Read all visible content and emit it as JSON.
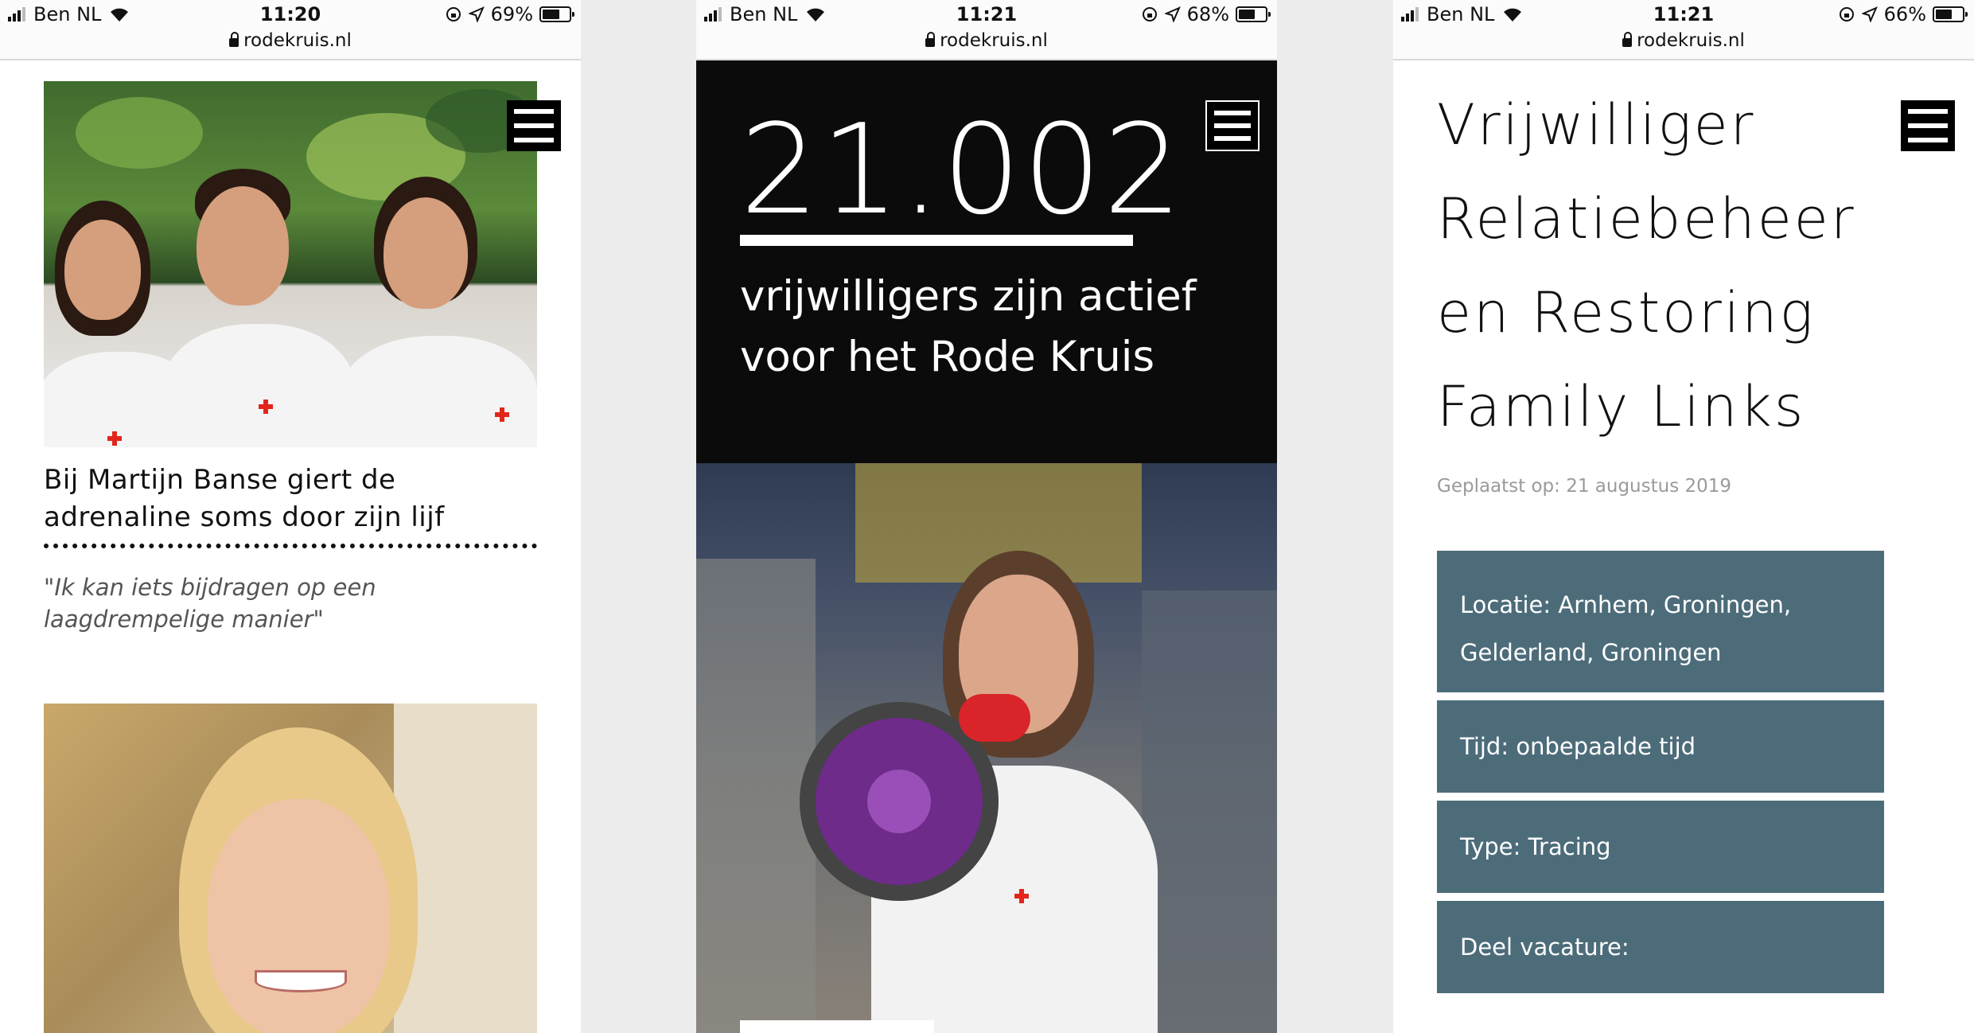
{
  "screens": [
    {
      "status": {
        "carrier": "Ben NL",
        "time": "11:20",
        "battery": "69%",
        "battery_level": 0.69,
        "url": "rodekruis.nl"
      },
      "article": {
        "title": "Bij Martijn Banse giert de adrenaline soms door zijn lijf",
        "quote": "\"Ik kan iets bijdragen op een laagdrempelige manier\""
      },
      "photo_logo": "Rode Kruis"
    },
    {
      "status": {
        "carrier": "Ben NL",
        "time": "11:21",
        "battery": "68%",
        "battery_level": 0.68,
        "url": "rodekruis.nl"
      },
      "stat": {
        "number": "21.002",
        "text": "vrijwilligers zijn actief voor het Rode Kruis"
      },
      "photo_logo": "Rode Kruis"
    },
    {
      "status": {
        "carrier": "Ben NL",
        "time": "11:21",
        "battery": "66%",
        "battery_level": 0.66,
        "url": "rodekruis.nl"
      },
      "job": {
        "title": "Vrijwilliger Relatiebeheer en Restoring Family Links",
        "posted": "Geplaatst op: 21 augustus 2019",
        "location_line1": "Locatie: Arnhem, Groningen,",
        "location_line2": "Gelderland, Groningen",
        "time": "Tijd: onbepaalde tijd",
        "type": "Type: Tracing",
        "share": "Deel vacature:"
      }
    }
  ],
  "colors": {
    "info_panel": "#4d6c7a",
    "black_band": "#0b0b0b",
    "cross": "#e3261c"
  },
  "icons": [
    "signal-icon",
    "wifi-icon",
    "rotation-lock-icon",
    "location-arrow-icon",
    "battery-icon",
    "lock-icon",
    "hamburger-menu-icon"
  ]
}
